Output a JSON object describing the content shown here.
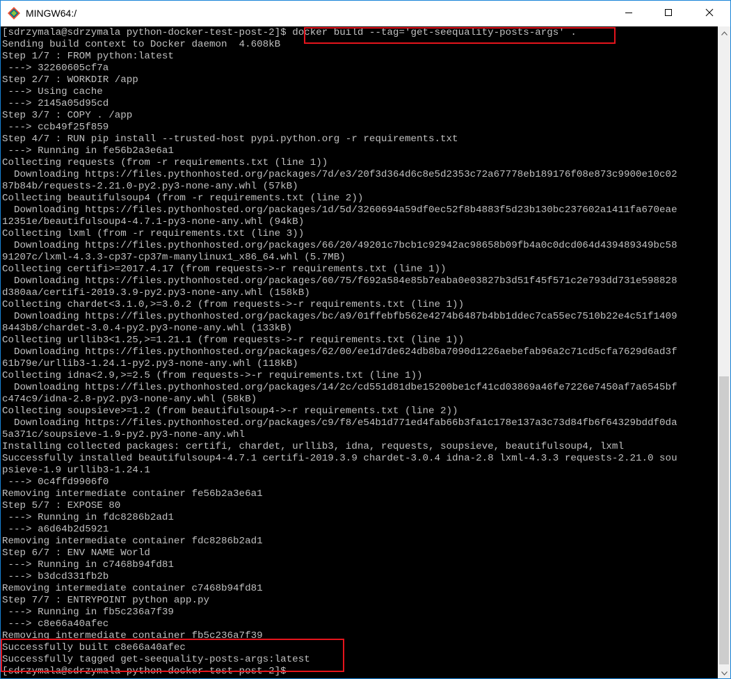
{
  "window": {
    "title": "MINGW64:/",
    "app_icon": "git-bash-icon",
    "controls": [
      "minimize-icon",
      "maximize-icon",
      "close-icon"
    ]
  },
  "terminal": {
    "colors": {
      "background": "#000000",
      "text": "#c0c0c0",
      "highlight_border": "#e5141c"
    },
    "prompt": "[sdrzymala@sdrzymala python-docker-test-post-2]$ ",
    "command": "docker build --tag='get-seequality-posts-args' .",
    "output_lines": [
      "Sending build context to Docker daemon  4.608kB",
      "Step 1/7 : FROM python:latest",
      " ---> 32260605cf7a",
      "Step 2/7 : WORKDIR /app",
      " ---> Using cache",
      " ---> 2145a05d95cd",
      "Step 3/7 : COPY . /app",
      " ---> ccb49f25f859",
      "Step 4/7 : RUN pip install --trusted-host pypi.python.org -r requirements.txt",
      " ---> Running in fe56b2a3e6a1",
      "Collecting requests (from -r requirements.txt (line 1))",
      "  Downloading https://files.pythonhosted.org/packages/7d/e3/20f3d364d6c8e5d2353c72a67778eb189176f08e873c9900e10c02",
      "87b84b/requests-2.21.0-py2.py3-none-any.whl (57kB)",
      "Collecting beautifulsoup4 (from -r requirements.txt (line 2))",
      "  Downloading https://files.pythonhosted.org/packages/1d/5d/3260694a59df0ec52f8b4883f5d23b130bc237602a1411fa670eae",
      "12351e/beautifulsoup4-4.7.1-py3-none-any.whl (94kB)",
      "Collecting lxml (from -r requirements.txt (line 3))",
      "  Downloading https://files.pythonhosted.org/packages/66/20/49201c7bcb1c92942ac98658b09fb4a0c0dcd064d439489349bc58",
      "91207c/lxml-4.3.3-cp37-cp37m-manylinux1_x86_64.whl (5.7MB)",
      "Collecting certifi>=2017.4.17 (from requests->-r requirements.txt (line 1))",
      "  Downloading https://files.pythonhosted.org/packages/60/75/f692a584e85b7eaba0e03827b3d51f45f571c2e793dd731e598828",
      "d380aa/certifi-2019.3.9-py2.py3-none-any.whl (158kB)",
      "Collecting chardet<3.1.0,>=3.0.2 (from requests->-r requirements.txt (line 1))",
      "  Downloading https://files.pythonhosted.org/packages/bc/a9/01ffebfb562e4274b6487b4bb1ddec7ca55ec7510b22e4c51f1409",
      "8443b8/chardet-3.0.4-py2.py3-none-any.whl (133kB)",
      "Collecting urllib3<1.25,>=1.21.1 (from requests->-r requirements.txt (line 1))",
      "  Downloading https://files.pythonhosted.org/packages/62/00/ee1d7de624db8ba7090d1226aebefab96a2c71cd5cfa7629d6ad3f",
      "61b79e/urllib3-1.24.1-py2.py3-none-any.whl (118kB)",
      "Collecting idna<2.9,>=2.5 (from requests->-r requirements.txt (line 1))",
      "  Downloading https://files.pythonhosted.org/packages/14/2c/cd551d81dbe15200be1cf41cd03869a46fe7226e7450af7a6545bf",
      "c474c9/idna-2.8-py2.py3-none-any.whl (58kB)",
      "Collecting soupsieve>=1.2 (from beautifulsoup4->-r requirements.txt (line 2))",
      "  Downloading https://files.pythonhosted.org/packages/c9/f8/e54b1d771ed4fab66b3fa1c178e137a3c73d84fb6f64329bddf0da",
      "5a371c/soupsieve-1.9-py2.py3-none-any.whl",
      "Installing collected packages: certifi, chardet, urllib3, idna, requests, soupsieve, beautifulsoup4, lxml",
      "Successfully installed beautifulsoup4-4.7.1 certifi-2019.3.9 chardet-3.0.4 idna-2.8 lxml-4.3.3 requests-2.21.0 sou",
      "psieve-1.9 urllib3-1.24.1",
      " ---> 0c4ffd9906f0",
      "Removing intermediate container fe56b2a3e6a1",
      "Step 5/7 : EXPOSE 80",
      " ---> Running in fdc8286b2ad1",
      " ---> a6d64b2d5921",
      "Removing intermediate container fdc8286b2ad1",
      "Step 6/7 : ENV NAME World",
      " ---> Running in c7468b94fd81",
      " ---> b3dcd331fb2b",
      "Removing intermediate container c7468b94fd81",
      "Step 7/7 : ENTRYPOINT python app.py",
      " ---> Running in fb5c236a7f39",
      " ---> c8e66a40afec",
      "Removing intermediate container fb5c236a7f39",
      "Successfully built c8e66a40afec",
      "Successfully tagged get-seequality-posts-args:latest"
    ],
    "final_prompt": "[sdrzymala@sdrzymala python-docker-test-post-2]$"
  },
  "scrollbar": {
    "up_icon": "scroll-up-arrow-icon",
    "down_icon": "scroll-down-arrow-icon"
  }
}
